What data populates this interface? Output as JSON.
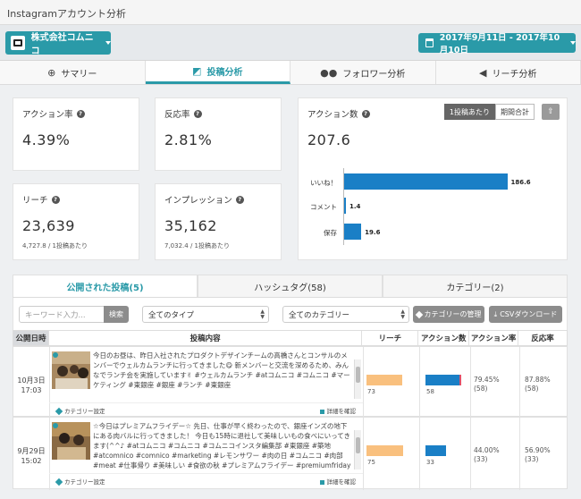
{
  "app": {
    "title": "Instagramアカウント分析"
  },
  "header": {
    "company": "株式会社コムニコ",
    "date_range": "2017年9月11日 - 2017年10月10日"
  },
  "tabs": [
    {
      "label": "サマリー",
      "icon": "globe-icon"
    },
    {
      "label": "投稿分析",
      "icon": "chart-icon",
      "active": true
    },
    {
      "label": "フォロワー分析",
      "icon": "users-icon"
    },
    {
      "label": "リーチ分析",
      "icon": "megaphone-icon"
    }
  ],
  "metrics": {
    "action_rate": {
      "label": "アクション率",
      "value": "4.39%"
    },
    "reaction_rate": {
      "label": "反応率",
      "value": "2.81%"
    },
    "reach": {
      "label": "リーチ",
      "value": "23,639",
      "sub": "4,727.8 / 1投稿あたり"
    },
    "impression": {
      "label": "インプレッション",
      "value": "35,162",
      "sub": "7,032.4 / 1投稿あたり"
    },
    "actions": {
      "label": "アクション数",
      "value": "207.6",
      "toggle_on": "1投稿あたり",
      "toggle_off": "期間合計"
    }
  },
  "chart_data": {
    "type": "bar",
    "orientation": "horizontal",
    "categories": [
      "いいね！",
      "コメント",
      "保存"
    ],
    "values": [
      186.6,
      1.4,
      19.6
    ],
    "value_labels": [
      "186.6",
      "1.4",
      "19.6"
    ],
    "xlim": [
      0,
      230
    ],
    "color": "#1a7fc6"
  },
  "post_tabs": {
    "published": "公開された投稿(5)",
    "hashtag": "ハッシュタグ(58)",
    "category": "カテゴリー(2)"
  },
  "filters": {
    "keyword_placeholder": "キーワード入力...",
    "search": "検索",
    "type": "全てのタイプ",
    "category": "全てのカテゴリー",
    "manage": "カテゴリーの管理",
    "csv": "CSVダウンロード"
  },
  "table": {
    "headers": [
      "公開日時",
      "投稿内容",
      "リーチ",
      "アクション数",
      "アクション率",
      "反応率"
    ],
    "rows": [
      {
        "date": "10月3日",
        "time": "17:03",
        "text": "今日のお昼は、昨日入社されたプロダクトデザインチームの高橋さんとコンサルのメンバーでウェルカムランチに行ってきました😋 新メンバーと交流を深めるため、みんなでランチ会を実施しています✌ #ウェルカムランチ #atコムニコ #コムニコ #マーケティング #東銀座 #銀座 #ランチ #東銀座",
        "category_btn": "カテゴリー設定",
        "detail_btn": "詳細を確認",
        "reach": "73",
        "reach_frac": 0.73,
        "actions": "58",
        "actions_frac": 0.8,
        "actions_pink_frac": 0.04,
        "action_rate": "79.45%",
        "action_rate_n": "(58)",
        "reaction_rate": "87.88%",
        "reaction_rate_n": "(58)"
      },
      {
        "date": "9月29日",
        "time": "15:02",
        "text": "☆今日はプレミアムフライデー☆ 先日、仕事が早く終わったので、銀座インズの地下にある肉バルに行ってきました！ 今日も15時に退社して美味しいもの食べにいってきます(^^♪ #atコムニコ #コムニコ #コムニコインスタ編集部 #東銀座 #築地 #atcomnico #comnico #marketing #レモンサワー #肉の日 #コムニコ #肉部 #meat #仕事帰り #美味しい #食欲の秋 #プレミアムフライデー #premiumfriday #プレ",
        "category_btn": "カテゴリー設定",
        "detail_btn": "詳細を確認",
        "reach": "75",
        "reach_frac": 0.75,
        "actions": "33",
        "actions_frac": 0.46,
        "actions_pink_frac": 0.0,
        "action_rate": "44.00%",
        "action_rate_n": "(33)",
        "reaction_rate": "56.90%",
        "reaction_rate_n": "(33)"
      }
    ]
  }
}
